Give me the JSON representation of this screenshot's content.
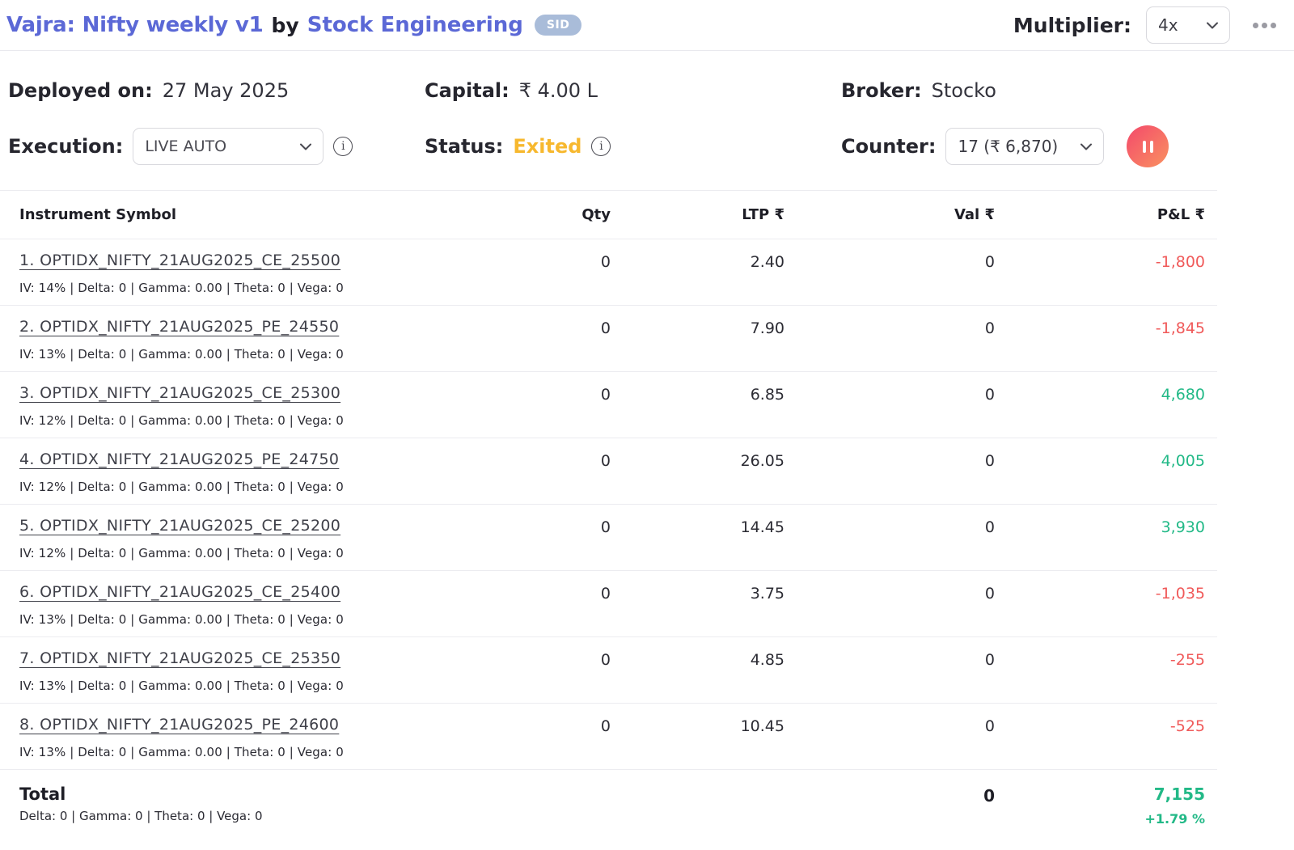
{
  "header": {
    "title": "Vajra: Nifty weekly v1",
    "by_text": "by",
    "author": "Stock Engineering",
    "badge": "SID",
    "multiplier_label": "Multiplier:",
    "multiplier_value": "4x"
  },
  "info": {
    "deployed_label": "Deployed on:",
    "deployed_value": "27 May 2025",
    "execution_label": "Execution:",
    "execution_value": "LIVE AUTO",
    "capital_label": "Capital:",
    "capital_value": "₹ 4.00 L",
    "status_label": "Status:",
    "status_value": "Exited",
    "broker_label": "Broker:",
    "broker_value": "Stocko",
    "counter_label": "Counter:",
    "counter_value": "17 (₹ 6,870)",
    "info_icon_glyph": "i"
  },
  "colors": {
    "accent_indigo": "#5b68d6",
    "status_amber": "#f7b82e",
    "positive_green": "#22b987",
    "negative_red": "#f05a5a",
    "badge_blue": "#a9bcd9",
    "pause_gradient_start": "#f4506a",
    "pause_gradient_end": "#f98e61"
  },
  "table": {
    "headers": {
      "symbol": "Instrument Symbol",
      "qty": "Qty",
      "ltp": "LTP ₹",
      "val": "Val ₹",
      "pnl": "P&L ₹"
    },
    "rows": [
      {
        "symbol": "1. OPTIDX_NIFTY_21AUG2025_CE_25500",
        "greeks": "IV: 14% | Delta: 0 | Gamma: 0.00 | Theta: 0 | Vega: 0",
        "qty": "0",
        "ltp": "2.40",
        "val": "0",
        "pnl": "-1,800",
        "pnl_sign": "neg"
      },
      {
        "symbol": "2. OPTIDX_NIFTY_21AUG2025_PE_24550",
        "greeks": "IV: 13% | Delta: 0 | Gamma: 0.00 | Theta: 0 | Vega: 0",
        "qty": "0",
        "ltp": "7.90",
        "val": "0",
        "pnl": "-1,845",
        "pnl_sign": "neg"
      },
      {
        "symbol": "3. OPTIDX_NIFTY_21AUG2025_CE_25300",
        "greeks": "IV: 12% | Delta: 0 | Gamma: 0.00 | Theta: 0 | Vega: 0",
        "qty": "0",
        "ltp": "6.85",
        "val": "0",
        "pnl": "4,680",
        "pnl_sign": "pos"
      },
      {
        "symbol": "4. OPTIDX_NIFTY_21AUG2025_PE_24750",
        "greeks": "IV: 12% | Delta: 0 | Gamma: 0.00 | Theta: 0 | Vega: 0",
        "qty": "0",
        "ltp": "26.05",
        "val": "0",
        "pnl": "4,005",
        "pnl_sign": "pos"
      },
      {
        "symbol": "5. OPTIDX_NIFTY_21AUG2025_CE_25200",
        "greeks": "IV: 12% | Delta: 0 | Gamma: 0.00 | Theta: 0 | Vega: 0",
        "qty": "0",
        "ltp": "14.45",
        "val": "0",
        "pnl": "3,930",
        "pnl_sign": "pos"
      },
      {
        "symbol": "6. OPTIDX_NIFTY_21AUG2025_CE_25400",
        "greeks": "IV: 13% | Delta: 0 | Gamma: 0.00 | Theta: 0 | Vega: 0",
        "qty": "0",
        "ltp": "3.75",
        "val": "0",
        "pnl": "-1,035",
        "pnl_sign": "neg"
      },
      {
        "symbol": "7. OPTIDX_NIFTY_21AUG2025_CE_25350",
        "greeks": "IV: 13% | Delta: 0 | Gamma: 0.00 | Theta: 0 | Vega: 0",
        "qty": "0",
        "ltp": "4.85",
        "val": "0",
        "pnl": "-255",
        "pnl_sign": "neg"
      },
      {
        "symbol": "8. OPTIDX_NIFTY_21AUG2025_PE_24600",
        "greeks": "IV: 13% | Delta: 0 | Gamma: 0.00 | Theta: 0 | Vega: 0",
        "qty": "0",
        "ltp": "10.45",
        "val": "0",
        "pnl": "-525",
        "pnl_sign": "neg"
      }
    ],
    "total": {
      "label": "Total",
      "greeks": "Delta: 0 | Gamma: 0  | Theta: 0 | Vega: 0",
      "val": "0",
      "pnl": "7,155",
      "pnl_pct": "+1.79 %"
    }
  }
}
